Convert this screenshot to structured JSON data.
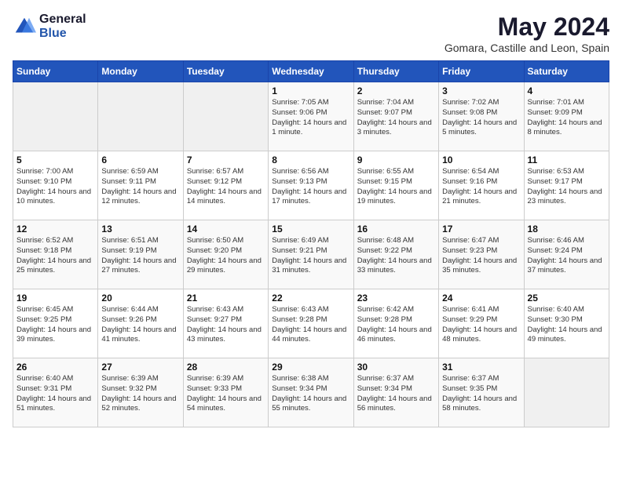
{
  "header": {
    "logo_general": "General",
    "logo_blue": "Blue",
    "title": "May 2024",
    "subtitle": "Gomara, Castille and Leon, Spain"
  },
  "weekdays": [
    "Sunday",
    "Monday",
    "Tuesday",
    "Wednesday",
    "Thursday",
    "Friday",
    "Saturday"
  ],
  "weeks": [
    [
      {
        "day": "",
        "sunrise": "",
        "sunset": "",
        "daylight": ""
      },
      {
        "day": "",
        "sunrise": "",
        "sunset": "",
        "daylight": ""
      },
      {
        "day": "",
        "sunrise": "",
        "sunset": "",
        "daylight": ""
      },
      {
        "day": "1",
        "sunrise": "Sunrise: 7:05 AM",
        "sunset": "Sunset: 9:06 PM",
        "daylight": "Daylight: 14 hours and 1 minute."
      },
      {
        "day": "2",
        "sunrise": "Sunrise: 7:04 AM",
        "sunset": "Sunset: 9:07 PM",
        "daylight": "Daylight: 14 hours and 3 minutes."
      },
      {
        "day": "3",
        "sunrise": "Sunrise: 7:02 AM",
        "sunset": "Sunset: 9:08 PM",
        "daylight": "Daylight: 14 hours and 5 minutes."
      },
      {
        "day": "4",
        "sunrise": "Sunrise: 7:01 AM",
        "sunset": "Sunset: 9:09 PM",
        "daylight": "Daylight: 14 hours and 8 minutes."
      }
    ],
    [
      {
        "day": "5",
        "sunrise": "Sunrise: 7:00 AM",
        "sunset": "Sunset: 9:10 PM",
        "daylight": "Daylight: 14 hours and 10 minutes."
      },
      {
        "day": "6",
        "sunrise": "Sunrise: 6:59 AM",
        "sunset": "Sunset: 9:11 PM",
        "daylight": "Daylight: 14 hours and 12 minutes."
      },
      {
        "day": "7",
        "sunrise": "Sunrise: 6:57 AM",
        "sunset": "Sunset: 9:12 PM",
        "daylight": "Daylight: 14 hours and 14 minutes."
      },
      {
        "day": "8",
        "sunrise": "Sunrise: 6:56 AM",
        "sunset": "Sunset: 9:13 PM",
        "daylight": "Daylight: 14 hours and 17 minutes."
      },
      {
        "day": "9",
        "sunrise": "Sunrise: 6:55 AM",
        "sunset": "Sunset: 9:15 PM",
        "daylight": "Daylight: 14 hours and 19 minutes."
      },
      {
        "day": "10",
        "sunrise": "Sunrise: 6:54 AM",
        "sunset": "Sunset: 9:16 PM",
        "daylight": "Daylight: 14 hours and 21 minutes."
      },
      {
        "day": "11",
        "sunrise": "Sunrise: 6:53 AM",
        "sunset": "Sunset: 9:17 PM",
        "daylight": "Daylight: 14 hours and 23 minutes."
      }
    ],
    [
      {
        "day": "12",
        "sunrise": "Sunrise: 6:52 AM",
        "sunset": "Sunset: 9:18 PM",
        "daylight": "Daylight: 14 hours and 25 minutes."
      },
      {
        "day": "13",
        "sunrise": "Sunrise: 6:51 AM",
        "sunset": "Sunset: 9:19 PM",
        "daylight": "Daylight: 14 hours and 27 minutes."
      },
      {
        "day": "14",
        "sunrise": "Sunrise: 6:50 AM",
        "sunset": "Sunset: 9:20 PM",
        "daylight": "Daylight: 14 hours and 29 minutes."
      },
      {
        "day": "15",
        "sunrise": "Sunrise: 6:49 AM",
        "sunset": "Sunset: 9:21 PM",
        "daylight": "Daylight: 14 hours and 31 minutes."
      },
      {
        "day": "16",
        "sunrise": "Sunrise: 6:48 AM",
        "sunset": "Sunset: 9:22 PM",
        "daylight": "Daylight: 14 hours and 33 minutes."
      },
      {
        "day": "17",
        "sunrise": "Sunrise: 6:47 AM",
        "sunset": "Sunset: 9:23 PM",
        "daylight": "Daylight: 14 hours and 35 minutes."
      },
      {
        "day": "18",
        "sunrise": "Sunrise: 6:46 AM",
        "sunset": "Sunset: 9:24 PM",
        "daylight": "Daylight: 14 hours and 37 minutes."
      }
    ],
    [
      {
        "day": "19",
        "sunrise": "Sunrise: 6:45 AM",
        "sunset": "Sunset: 9:25 PM",
        "daylight": "Daylight: 14 hours and 39 minutes."
      },
      {
        "day": "20",
        "sunrise": "Sunrise: 6:44 AM",
        "sunset": "Sunset: 9:26 PM",
        "daylight": "Daylight: 14 hours and 41 minutes."
      },
      {
        "day": "21",
        "sunrise": "Sunrise: 6:43 AM",
        "sunset": "Sunset: 9:27 PM",
        "daylight": "Daylight: 14 hours and 43 minutes."
      },
      {
        "day": "22",
        "sunrise": "Sunrise: 6:43 AM",
        "sunset": "Sunset: 9:28 PM",
        "daylight": "Daylight: 14 hours and 44 minutes."
      },
      {
        "day": "23",
        "sunrise": "Sunrise: 6:42 AM",
        "sunset": "Sunset: 9:28 PM",
        "daylight": "Daylight: 14 hours and 46 minutes."
      },
      {
        "day": "24",
        "sunrise": "Sunrise: 6:41 AM",
        "sunset": "Sunset: 9:29 PM",
        "daylight": "Daylight: 14 hours and 48 minutes."
      },
      {
        "day": "25",
        "sunrise": "Sunrise: 6:40 AM",
        "sunset": "Sunset: 9:30 PM",
        "daylight": "Daylight: 14 hours and 49 minutes."
      }
    ],
    [
      {
        "day": "26",
        "sunrise": "Sunrise: 6:40 AM",
        "sunset": "Sunset: 9:31 PM",
        "daylight": "Daylight: 14 hours and 51 minutes."
      },
      {
        "day": "27",
        "sunrise": "Sunrise: 6:39 AM",
        "sunset": "Sunset: 9:32 PM",
        "daylight": "Daylight: 14 hours and 52 minutes."
      },
      {
        "day": "28",
        "sunrise": "Sunrise: 6:39 AM",
        "sunset": "Sunset: 9:33 PM",
        "daylight": "Daylight: 14 hours and 54 minutes."
      },
      {
        "day": "29",
        "sunrise": "Sunrise: 6:38 AM",
        "sunset": "Sunset: 9:34 PM",
        "daylight": "Daylight: 14 hours and 55 minutes."
      },
      {
        "day": "30",
        "sunrise": "Sunrise: 6:37 AM",
        "sunset": "Sunset: 9:34 PM",
        "daylight": "Daylight: 14 hours and 56 minutes."
      },
      {
        "day": "31",
        "sunrise": "Sunrise: 6:37 AM",
        "sunset": "Sunset: 9:35 PM",
        "daylight": "Daylight: 14 hours and 58 minutes."
      },
      {
        "day": "",
        "sunrise": "",
        "sunset": "",
        "daylight": ""
      }
    ]
  ]
}
